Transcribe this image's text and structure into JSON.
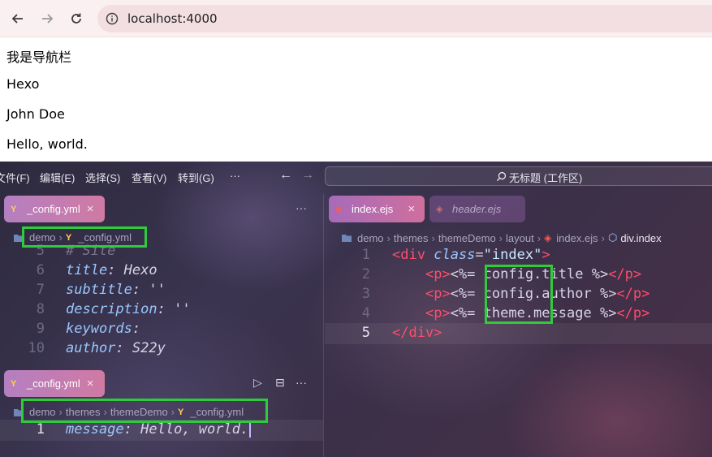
{
  "browser": {
    "url": "localhost:4000",
    "icons": [
      "back-arrow-icon",
      "forward-arrow-icon",
      "reload-icon",
      "info-icon"
    ]
  },
  "page": {
    "lines": [
      "我是导航栏",
      "Hexo",
      "John Doe",
      "Hello, world."
    ]
  },
  "editor": {
    "menu": [
      "文件(F)",
      "编辑(E)",
      "选择(S)",
      "查看(V)",
      "转到(G)",
      "···"
    ],
    "command_center": "无标题 (工作区)",
    "left_top": {
      "tab": {
        "icon": "Y",
        "label": "_config.yml",
        "close": "×"
      },
      "more": "···",
      "breadcrumb": [
        "demo",
        "_config.yml"
      ],
      "line_numbers": [
        "5",
        "6",
        "7",
        "8",
        "9",
        "10"
      ],
      "lines": [
        {
          "comment": "# Site"
        },
        {
          "key": "title",
          "value": "Hexo"
        },
        {
          "key": "subtitle",
          "value": "''"
        },
        {
          "key": "description",
          "value": "''"
        },
        {
          "key": "keywords",
          "value": ""
        },
        {
          "key": "author",
          "value": "S22y"
        }
      ]
    },
    "left_bottom": {
      "tab": {
        "icon": "Y",
        "label": "_config.yml",
        "close": "×"
      },
      "actions": [
        "▷",
        "⊟",
        "···"
      ],
      "breadcrumb": [
        "demo",
        "themes",
        "themeDemo",
        "_config.yml"
      ],
      "line_numbers": [
        "1"
      ],
      "lines": [
        {
          "key": "message",
          "value": "Hello, world."
        }
      ]
    },
    "right": {
      "tabs": [
        {
          "label": "index.ejs",
          "close": "×"
        },
        {
          "label": "header.ejs"
        }
      ],
      "breadcrumb": [
        "demo",
        "themes",
        "themeDemo",
        "layout",
        "index.ejs",
        "div.index"
      ],
      "line_numbers": [
        "1",
        "2",
        "3",
        "4",
        "5"
      ],
      "code": {
        "l1": {
          "open": "<",
          "tag": "div",
          "attr": "class",
          "eq": "=",
          "val": "\"index\"",
          "close": ">"
        },
        "l2": {
          "p_open": "<p>",
          "ejs_open": "<%=",
          "expr": "config.title",
          "ejs_close": "%>",
          "p_close": "</p>"
        },
        "l3": {
          "p_open": "<p>",
          "ejs_open": "<%=",
          "expr": "config.author",
          "ejs_close": "%>",
          "p_close": "</p>"
        },
        "l4": {
          "p_open": "<p>",
          "ejs_open": "<%=",
          "expr": "theme.message",
          "ejs_close": "%>",
          "p_close": "</p>"
        },
        "l5": {
          "close": "</div>"
        }
      }
    },
    "highlight_color": "#2fcb3c"
  }
}
